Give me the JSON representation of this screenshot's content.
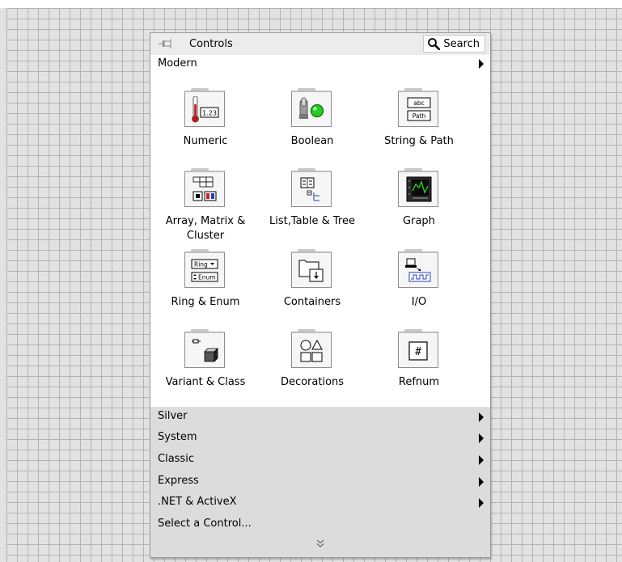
{
  "palette": {
    "title": "Controls",
    "search_label": "Search",
    "modern_label": "Modern",
    "items": [
      {
        "label": "Numeric",
        "icon": "numeric-icon"
      },
      {
        "label": "Boolean",
        "icon": "boolean-icon"
      },
      {
        "label": "String & Path",
        "icon": "string-path-icon"
      },
      {
        "label": "Array, Matrix & Cluster",
        "icon": "array-matrix-cluster-icon"
      },
      {
        "label": "List,Table & Tree",
        "icon": "list-table-tree-icon"
      },
      {
        "label": "Graph",
        "icon": "graph-icon"
      },
      {
        "label": "Ring & Enum",
        "icon": "ring-enum-icon"
      },
      {
        "label": "Containers",
        "icon": "containers-icon"
      },
      {
        "label": "I/O",
        "icon": "io-icon"
      },
      {
        "label": "Variant & Class",
        "icon": "variant-class-icon"
      },
      {
        "label": "Decorations",
        "icon": "decorations-icon"
      },
      {
        "label": "Refnum",
        "icon": "refnum-icon"
      }
    ],
    "icon_text": {
      "numeric": "1.23",
      "string_top": "abc",
      "string_bottom": "Path",
      "ring": "Ring",
      "enum": "Enum",
      "refnum": "#"
    },
    "categories": [
      {
        "label": "Silver",
        "has_submenu": true
      },
      {
        "label": "System",
        "has_submenu": true
      },
      {
        "label": "Classic",
        "has_submenu": true
      },
      {
        "label": "Express",
        "has_submenu": true
      },
      {
        "label": ".NET & ActiveX",
        "has_submenu": true
      },
      {
        "label": "Select a Control...",
        "has_submenu": false
      }
    ]
  },
  "colors": {
    "grid_background": "#e2e2e2",
    "grid_line": "#b4b4b4",
    "palette_body": "#ffffff",
    "category_band": "#dcdcdc",
    "boolean_led": "#22cc22",
    "numeric_thermometer": "#cc1111"
  }
}
